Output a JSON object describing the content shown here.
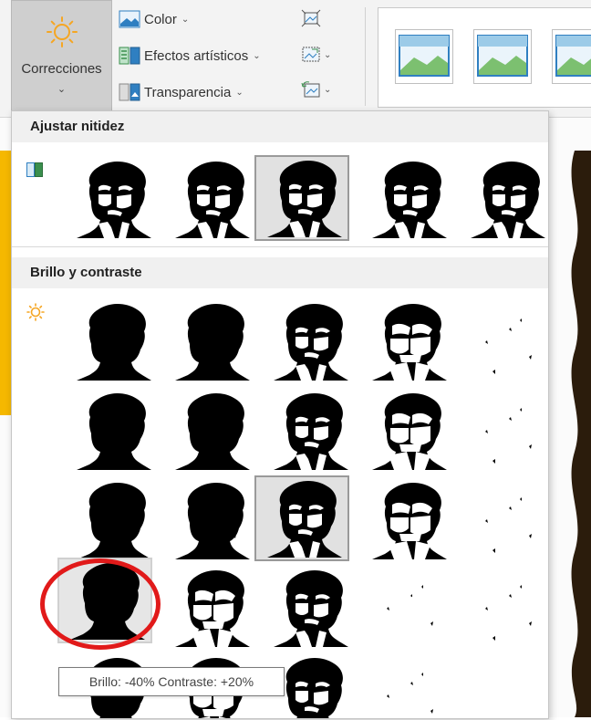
{
  "ribbon": {
    "corrections_label": "Correcciones",
    "color_label": "Color",
    "artistic_effects_label": "Efectos artísticos",
    "transparency_label": "Transparencia"
  },
  "dropdown": {
    "sharpen_header": "Ajustar nitidez",
    "brightness_header": "Brillo y contraste"
  },
  "tooltip": "Brillo: -40% Contraste: +20%",
  "colors": {
    "accent_sun": "#f5a623",
    "selection_border": "#9a9a9a",
    "annotation_red": "#e11a1a"
  }
}
